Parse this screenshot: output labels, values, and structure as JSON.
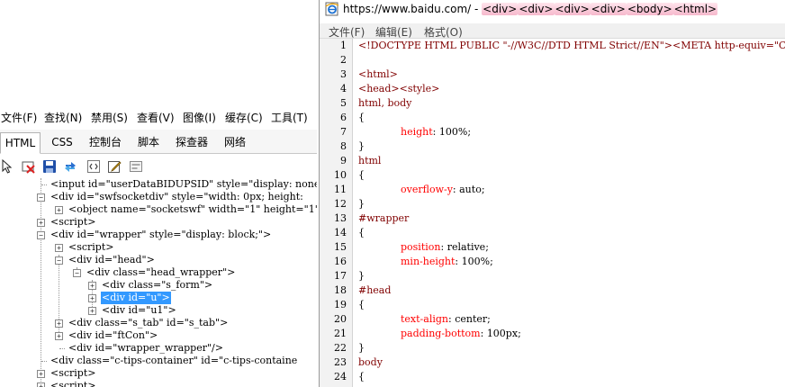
{
  "devtools": {
    "menu": [
      "文件(F)",
      "查找(N)",
      "禁用(S)",
      "查看(V)",
      "图像(I)",
      "缓存(C)",
      "工具(T)"
    ],
    "tabs": [
      "HTML",
      "CSS",
      "控制台",
      "脚本",
      "探查器",
      "网络"
    ],
    "active_tab": "HTML",
    "toolbar_icons": [
      "select-element-icon",
      "clear-icon",
      "save-icon",
      "refresh-icon",
      "word-wrap-icon",
      "edit-icon",
      "dom-icon"
    ],
    "tree_rows": [
      {
        "text": "<input id=\"userDataBIDUPSID\" style=\"display: none",
        "expander": "none"
      },
      {
        "text": "<div id=\"swfsocketdiv\" style=\"width: 0px; height:",
        "expander": "minus"
      },
      {
        "text": "<object name=\"socketswf\" width=\"1\" height=\"1\"",
        "expander": "plus"
      },
      {
        "text": "<script>",
        "expander": "plus"
      },
      {
        "text": "<div id=\"wrapper\" style=\"display: block;\">",
        "expander": "minus"
      },
      {
        "text": "<script>",
        "expander": "plus"
      },
      {
        "text": "<div id=\"head\">",
        "expander": "minus"
      },
      {
        "text": "<div class=\"head_wrapper\">",
        "expander": "minus"
      },
      {
        "text": "<div class=\"s_form\">",
        "expander": "plus"
      },
      {
        "text": "<div id=\"u\">",
        "expander": "plus",
        "selected": true
      },
      {
        "text": "<div id=\"u1\">",
        "expander": "plus"
      },
      {
        "text": "<div class=\"s_tab\" id=\"s_tab\">",
        "expander": "plus"
      },
      {
        "text": "<div id=\"ftCon\">",
        "expander": "plus"
      },
      {
        "text": "<div id=\"wrapper_wrapper\"/>",
        "expander": "none"
      },
      {
        "text": "<div class=\"c-tips-container\" id=\"c-tips-containe",
        "expander": "none"
      },
      {
        "text": "<script>",
        "expander": "plus"
      },
      {
        "text": "<script>",
        "expander": "plus"
      }
    ]
  },
  "source_window": {
    "url": "https://www.baidu.com/",
    "separator": " - ",
    "tags": [
      "<div>",
      "<div>",
      "<div>",
      "<div>",
      "<body>",
      "<html>"
    ],
    "menu": [
      "文件(F)",
      "编辑(E)",
      "格式(O)"
    ],
    "lines": [
      {
        "n": "1",
        "code": "<!DOCTYPE HTML PUBLIC \"-//W3C//DTD HTML Strict//EN\"><META http-equiv=\"Content-Ty",
        "kind": "tag"
      },
      {
        "n": "2",
        "code": "",
        "kind": "tag"
      },
      {
        "n": "3",
        "code": "<html>",
        "kind": "tag"
      },
      {
        "n": "4",
        "code": "<head><style>",
        "kind": "tag"
      },
      {
        "n": "5",
        "code": "html, body",
        "kind": "tag"
      },
      {
        "n": "6",
        "code": "{",
        "kind": "brace"
      },
      {
        "n": "7",
        "prop": "height",
        "val": "100%",
        "kind": "decl"
      },
      {
        "n": "8",
        "code": "}",
        "kind": "brace"
      },
      {
        "n": "9",
        "code": "html",
        "kind": "tag"
      },
      {
        "n": "10",
        "code": "{",
        "kind": "brace"
      },
      {
        "n": "11",
        "prop": "overflow-y",
        "val": "auto",
        "kind": "decl"
      },
      {
        "n": "12",
        "code": "}",
        "kind": "brace"
      },
      {
        "n": "13",
        "code": "#wrapper",
        "kind": "tag"
      },
      {
        "n": "14",
        "code": "{",
        "kind": "brace"
      },
      {
        "n": "15",
        "prop": "position",
        "val": "relative",
        "kind": "decl"
      },
      {
        "n": "16",
        "prop": "min-height",
        "val": "100%",
        "kind": "decl"
      },
      {
        "n": "17",
        "code": "}",
        "kind": "brace"
      },
      {
        "n": "18",
        "code": "#head",
        "kind": "tag"
      },
      {
        "n": "19",
        "code": "{",
        "kind": "brace"
      },
      {
        "n": "20",
        "prop": "text-align",
        "val": "center",
        "kind": "decl"
      },
      {
        "n": "21",
        "prop": "padding-bottom",
        "val": "100px",
        "kind": "decl"
      },
      {
        "n": "22",
        "code": "}",
        "kind": "brace"
      },
      {
        "n": "23",
        "code": "body",
        "kind": "tag"
      },
      {
        "n": "24",
        "code": "{",
        "kind": "brace"
      }
    ]
  },
  "colors": {
    "selection": "#3399ff",
    "tag": "#800000",
    "property": "#ff0000"
  }
}
